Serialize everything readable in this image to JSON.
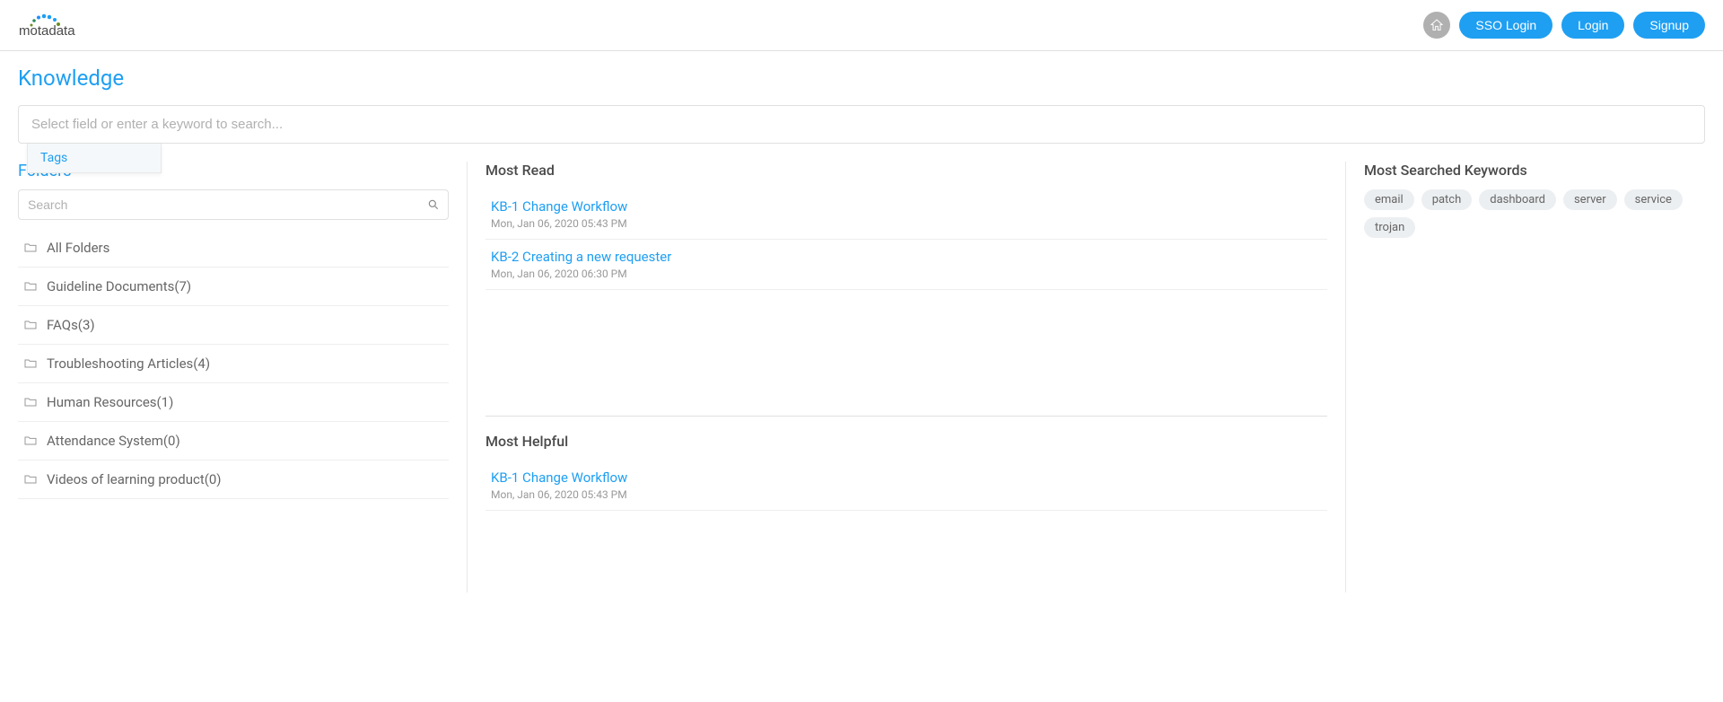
{
  "header": {
    "sso_login": "SSO Login",
    "login": "Login",
    "signup": "Signup"
  },
  "page": {
    "title": "Knowledge"
  },
  "search": {
    "placeholder": "Select field or enter a keyword to search...",
    "dropdown_item": "Tags"
  },
  "folders": {
    "title": "Folders",
    "search_placeholder": "Search",
    "items": [
      {
        "label": "All Folders"
      },
      {
        "label": "Guideline Documents(7)"
      },
      {
        "label": "FAQs(3)"
      },
      {
        "label": "Troubleshooting Articles(4)"
      },
      {
        "label": "Human Resources(1)"
      },
      {
        "label": "Attendance System(0)"
      },
      {
        "label": "Videos of learning product(0)"
      }
    ]
  },
  "most_read": {
    "title": "Most Read",
    "items": [
      {
        "title": "KB-1 Change Workflow",
        "date": "Mon, Jan 06, 2020 05:43 PM"
      },
      {
        "title": "KB-2 Creating a new requester",
        "date": "Mon, Jan 06, 2020 06:30 PM"
      }
    ]
  },
  "most_helpful": {
    "title": "Most Helpful",
    "items": [
      {
        "title": "KB-1 Change Workflow",
        "date": "Mon, Jan 06, 2020 05:43 PM"
      }
    ]
  },
  "keywords": {
    "title": "Most Searched Keywords",
    "items": [
      "email",
      "patch",
      "dashboard",
      "server",
      "service",
      "trojan"
    ]
  }
}
